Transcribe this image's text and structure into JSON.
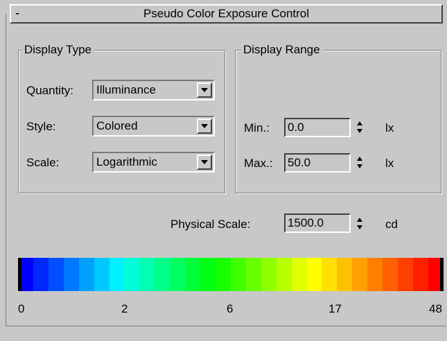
{
  "header": {
    "collapse_symbol": "-",
    "title": "Pseudo Color Exposure Control"
  },
  "display_type": {
    "title": "Display Type",
    "quantity": {
      "label": "Quantity:",
      "value": "Illuminance"
    },
    "style": {
      "label": "Style:",
      "value": "Colored"
    },
    "scale": {
      "label": "Scale:",
      "value": "Logarithmic"
    }
  },
  "display_range": {
    "title": "Display Range",
    "min": {
      "label": "Min.:",
      "value": "0.0",
      "unit": "lx"
    },
    "max": {
      "label": "Max.:",
      "value": "50.0",
      "unit": "lx"
    }
  },
  "physical_scale": {
    "label": "Physical Scale:",
    "value": "1500.0",
    "unit": "cd"
  },
  "color_bar": {
    "colors": [
      "#0000ff",
      "#0028ff",
      "#0050ff",
      "#0078ff",
      "#00a0ff",
      "#00c8ff",
      "#00f0ff",
      "#00ffd8",
      "#00ffb0",
      "#00ff88",
      "#00ff60",
      "#00ff38",
      "#00ff10",
      "#18ff00",
      "#40ff00",
      "#68ff00",
      "#90ff00",
      "#b8ff00",
      "#e0ff00",
      "#ffff00",
      "#ffe000",
      "#ffc000",
      "#ffa000",
      "#ff8000",
      "#ff6000",
      "#ff4000",
      "#ff2000",
      "#ff0000"
    ],
    "tick_labels": [
      "0",
      "2",
      "6",
      "17",
      "48"
    ]
  }
}
